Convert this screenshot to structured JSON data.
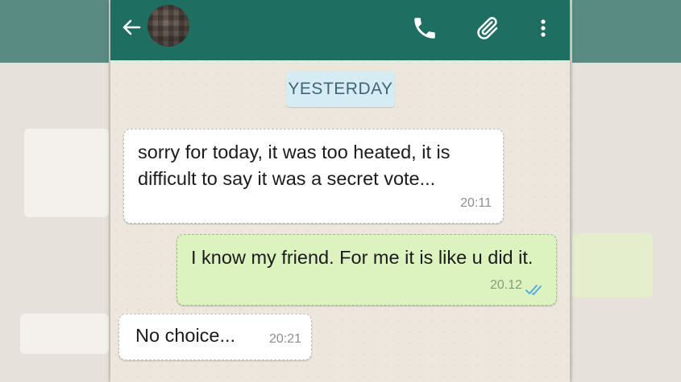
{
  "header": {
    "back_icon": "back-arrow-icon",
    "avatar": "blurred-avatar",
    "actions": [
      "phone-icon",
      "paperclip-icon",
      "more-vert-icon"
    ],
    "bar_color": "#1f6e62"
  },
  "chat": {
    "date_divider": "YESTERDAY",
    "messages": [
      {
        "direction": "incoming",
        "text": "sorry for today, it was too heated, it is difficult to say it was a secret vote...",
        "time": "20:11"
      },
      {
        "direction": "outgoing",
        "text": "I know my friend. For me it is like u did it.",
        "time": "20.12",
        "status_icon": "double-check-icon",
        "status_color": "#4fa6e0"
      },
      {
        "direction": "incoming",
        "text": "No choice...",
        "time": "20:21"
      }
    ]
  },
  "colors": {
    "incoming_bubble": "#ffffff",
    "outgoing_bubble": "#dcf3c0",
    "chat_background": "#ece6dc",
    "date_chip": "#d6ecf5"
  }
}
